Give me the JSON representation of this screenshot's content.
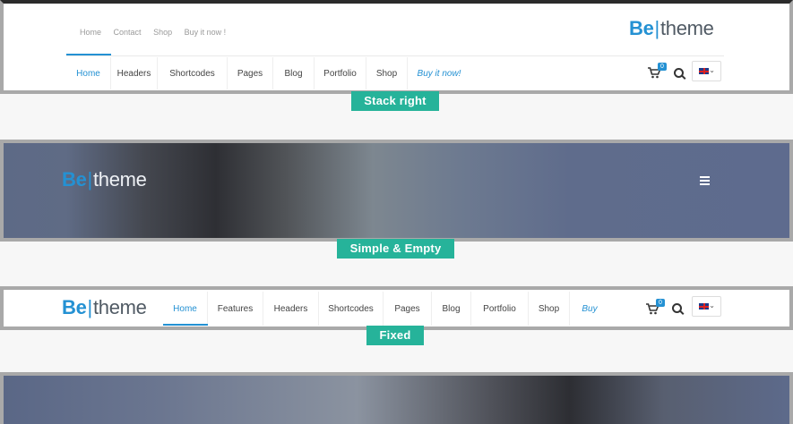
{
  "frame1": {
    "top_links": [
      "Home",
      "Contact",
      "Shop",
      "Buy it now !"
    ],
    "logo": {
      "be": "Be",
      "bar": "|",
      "theme": "theme"
    },
    "nav": [
      "Home",
      "Headers",
      "Shortcodes",
      "Pages",
      "Blog",
      "Portfolio",
      "Shop",
      "Buy it now!"
    ],
    "cart_count": "0",
    "label": "Stack right"
  },
  "frame2": {
    "logo": {
      "be": "Be",
      "bar": "|",
      "theme": "theme"
    },
    "label": "Simple & Empty"
  },
  "frame3": {
    "logo": {
      "be": "Be",
      "bar": "|",
      "theme": "theme"
    },
    "nav": [
      "Home",
      "Features",
      "Headers",
      "Shortcodes",
      "Pages",
      "Blog",
      "Portfolio",
      "Shop",
      "Buy"
    ],
    "cart_count": "0",
    "label": "Fixed"
  },
  "colors": {
    "accent": "#2491d3",
    "label_bg": "#26b39a",
    "frame_border": "#a9a9a9"
  },
  "icons": [
    "cart-icon",
    "search-icon",
    "uk-flag-icon",
    "chevron-down-icon",
    "hamburger-icon"
  ]
}
